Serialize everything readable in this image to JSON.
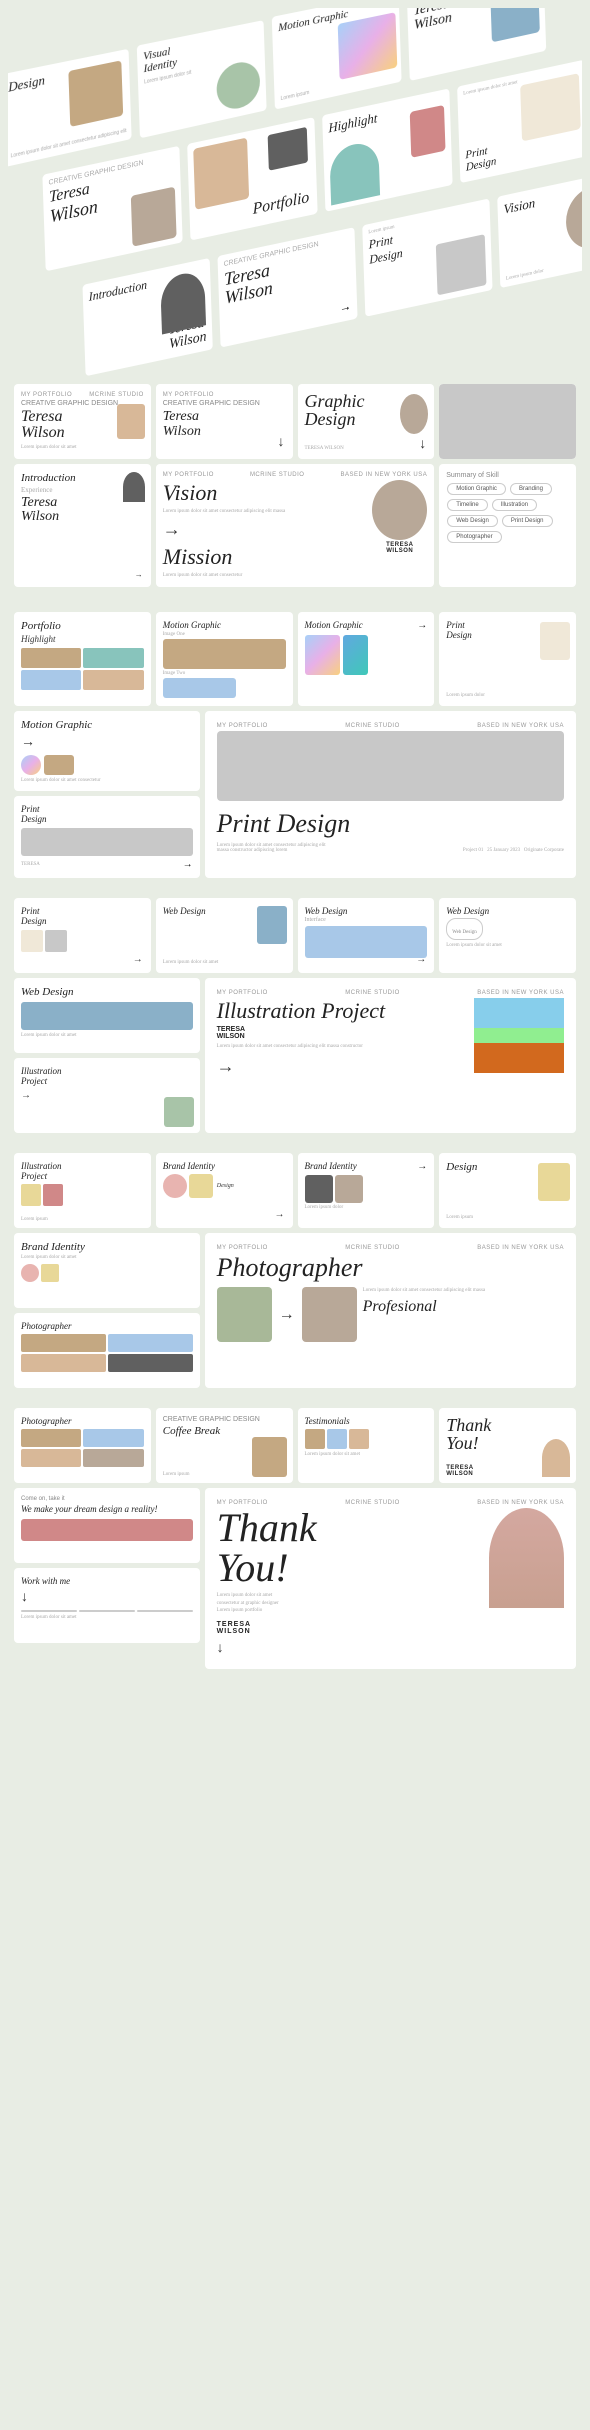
{
  "title": "Teresa Wilson - Creative Graphic Design Portfolio",
  "iso_section": {
    "cards": [
      {
        "title": "Design",
        "type": "photo"
      },
      {
        "title": "Visual Identity",
        "type": "text"
      },
      {
        "title": "Motion Graphic",
        "type": "gradient"
      },
      {
        "title": "Vision",
        "type": "photo"
      },
      {
        "title": "Teresa Wilson",
        "type": "serif"
      },
      {
        "title": "Portfolio",
        "type": "photo"
      },
      {
        "title": "Highlight",
        "type": "photo"
      },
      {
        "title": "Introduction",
        "type": "dark"
      },
      {
        "title": "Teresa Wilson",
        "type": "serif2"
      },
      {
        "title": "Print Design",
        "type": "minimal"
      }
    ]
  },
  "sections": [
    {
      "id": "section1",
      "rows": [
        {
          "type": "row4",
          "slides": [
            {
              "type": "teresa-intro",
              "label": "Teresa Wilson",
              "sub": "Creative Graphic Design"
            },
            {
              "type": "creative-gd",
              "label": "Creative Graphic Design",
              "sub": "Teresa Wilson"
            },
            {
              "type": "graphic-design",
              "label": "Graphic Design"
            },
            {
              "type": "teresa-photo",
              "label": ""
            }
          ]
        },
        {
          "type": "row4",
          "slides": [
            {
              "type": "introduction",
              "label": "Introduction",
              "sub": "Teresa Wilson"
            },
            {
              "type": "vision-mission",
              "label": "Vision",
              "sub": "Mission"
            },
            {
              "type": "vision-large",
              "label": ""
            },
            {
              "type": "mission-right",
              "label": "Mission"
            }
          ]
        }
      ]
    },
    {
      "id": "section2",
      "rows": [
        {
          "type": "row4",
          "slides": [
            {
              "type": "portfolio-highlight",
              "label": "Portfolio Highlight"
            },
            {
              "type": "motion-graphic-sm",
              "label": "Motion Graphic"
            },
            {
              "type": "motion-graphic-sm2",
              "label": "Motion Graphic"
            },
            {
              "type": "print-design-sm",
              "label": "Print Design"
            }
          ]
        },
        {
          "type": "row-1-3",
          "left": {
            "label": "Motion Graphic"
          },
          "right": {
            "label": "Print Design"
          }
        }
      ]
    },
    {
      "id": "section3",
      "rows": [
        {
          "type": "row4",
          "slides": [
            {
              "type": "print-design",
              "label": "Print Design"
            },
            {
              "type": "web-design",
              "label": "Web Design"
            },
            {
              "type": "web-design2",
              "label": "Web Design"
            },
            {
              "type": "web-design3",
              "label": "Web Design"
            }
          ]
        },
        {
          "type": "row-1-3",
          "left": {
            "label": "Web Design"
          },
          "right": {
            "label": "Illustration Project",
            "sub": "Teresa Wilson"
          }
        }
      ]
    },
    {
      "id": "section4",
      "rows": [
        {
          "type": "row4",
          "slides": [
            {
              "type": "illustration",
              "label": "Illustration Project"
            },
            {
              "type": "brand-identity",
              "label": "Brand Identity"
            },
            {
              "type": "brand-identity2",
              "label": "Brand Identity"
            },
            {
              "type": "brand-design",
              "label": "Design"
            }
          ]
        },
        {
          "type": "row-1-3",
          "left": {
            "label": "Brand Identity"
          },
          "right": {
            "label": "Photographer",
            "sub": "Profesional"
          }
        }
      ]
    },
    {
      "id": "section5",
      "rows": [
        {
          "type": "row4",
          "slides": [
            {
              "type": "photographer",
              "label": "Photographer"
            },
            {
              "type": "creative-gd2",
              "label": "Creative Graphic Design"
            },
            {
              "type": "testimonials",
              "label": "Testimonials"
            },
            {
              "type": "thankyou",
              "label": "Thank You"
            }
          ]
        },
        {
          "type": "row-1-3",
          "left": {
            "label": "Work with me"
          },
          "right": {
            "label": "Thank You!",
            "sub": "Teresa Wilson"
          }
        }
      ]
    }
  ],
  "labels": {
    "my_portfolio": "My Portfolio",
    "mc_rine_studio": "McRine Studio",
    "based_in": "Based in New York USA",
    "teresa_wilson": "Teresa Wilson",
    "creative_gd": "CREATIVE GRAPHIC DESIGN",
    "vision": "Vision",
    "mission": "Mission",
    "portfolio": "Portfolio",
    "highlight": "Highlight",
    "introduction": "Introduction",
    "motion_graphic": "Motion Graphic",
    "print_design": "Print Design",
    "web_design": "Web Design",
    "illustration": "Illustration Project",
    "brand_identity": "Brand Identity",
    "photographer": "Photographer",
    "profesional": "Profesional",
    "testimonials": "Testimonials",
    "thank_you": "Thank You!",
    "work_with_me": "Work with me",
    "coffee_break": "Coffee Break",
    "design": "Design",
    "come_on": "Come on, take it",
    "dream": "We make your dream design a reality!",
    "lorem": "Lorem ipsum dolor sit amet consectetur adipiscing elit massa consectetur",
    "experience": "Experience",
    "skill": "Summary of Skill",
    "arrow": "→",
    "down_arrow": "↓"
  }
}
